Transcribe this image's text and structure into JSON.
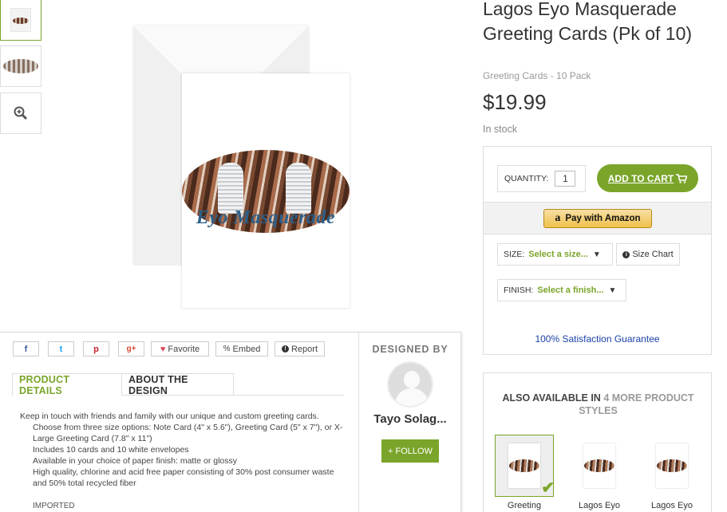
{
  "gallery": {
    "thumbnails": [
      "thumbnail-front",
      "thumbnail-oval"
    ],
    "zoom_icon": "zoom-in-icon",
    "card_text": "Eyo Masquerade"
  },
  "product": {
    "title": "Lagos Eyo Masquerade Greeting Cards (Pk of 10)",
    "subtitle": "Greeting Cards - 10 Pack",
    "price": "$19.99",
    "stock": "In stock"
  },
  "buybox": {
    "quantity_label": "QUANTITY:",
    "quantity_value": "1",
    "add_to_cart": "ADD TO CART",
    "amazon_label": "Pay with Amazon",
    "size_label": "SIZE:",
    "size_value": "Select a size...",
    "size_chart": "Size Chart",
    "finish_label": "FINISH:",
    "finish_value": "Select a finish...",
    "guarantee": "100% Satisfaction Guarantee"
  },
  "also_available": {
    "prefix": "ALSO AVAILABLE IN",
    "highlight": "4 MORE PRODUCT STYLES",
    "styles": [
      "Greeting",
      "Lagos Eyo",
      "Lagos Eyo"
    ]
  },
  "share": {
    "facebook": "f",
    "twitter": "t",
    "pinterest": "p",
    "google": "g+",
    "favorite": "Favorite",
    "embed": "Embed",
    "report": "Report"
  },
  "tabs": {
    "details": "PRODUCT DETAILS",
    "about": "ABOUT THE DESIGN"
  },
  "description": {
    "intro": "Keep in touch with friends and family with our unique and custom greeting cards.",
    "bullets": [
      "Choose from three size options: Note Card (4\" x 5.6\"), Greeting Card (5\" x 7\"), or X-Large Greeting Card (7.8\" x 11\")",
      "Includes 10 cards and 10 white envelopes",
      "Available in your choice of paper finish: matte or glossy",
      "High quality, chlorine and acid free paper consisting of 30% post consumer waste and 50% total recycled fiber"
    ],
    "imported": "IMPORTED"
  },
  "designer": {
    "heading": "DESIGNED BY",
    "name": "Tayo Solag...",
    "follow": "+ FOLLOW"
  },
  "colors": {
    "accent": "#7aa52a",
    "guarantee": "#1a3fa8",
    "amazon": "#f0c14b"
  }
}
